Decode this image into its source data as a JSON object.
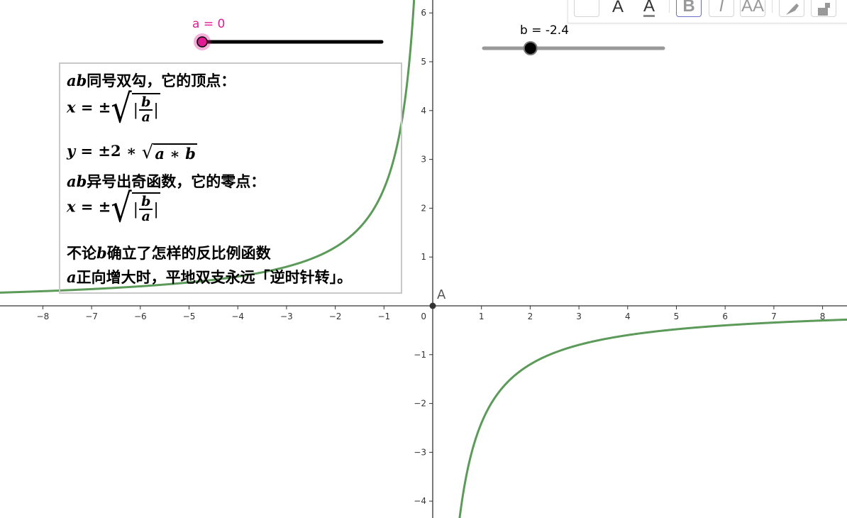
{
  "chart_data": {
    "type": "line",
    "title": "",
    "xlabel": "",
    "ylabel": "",
    "xlim": [
      -8.85,
      8.5
    ],
    "ylim": [
      -4.35,
      6.25
    ],
    "x_ticks": [
      -8,
      -7,
      -6,
      -5,
      -4,
      -3,
      -2,
      -1,
      1,
      2,
      3,
      4,
      5,
      6,
      7,
      8
    ],
    "y_ticks": [
      -4,
      -3,
      -2,
      -1,
      1,
      2,
      3,
      4,
      5,
      6
    ],
    "origin_label": "0",
    "grid": false,
    "series": [
      {
        "function": "y = b / x",
        "parameter_b": -2.4,
        "color": "#5b9a59"
      }
    ],
    "points": [
      {
        "name": "A",
        "x": 0,
        "y": 0,
        "color": "#333333"
      }
    ]
  },
  "sliders": {
    "a": {
      "label": "a = 0",
      "value": 0,
      "min": -5,
      "max": 5,
      "color": "#e21b95"
    },
    "b": {
      "label": "b = -2.4",
      "value": -2.4,
      "min": -5,
      "max": 5,
      "color": "#000000"
    }
  },
  "text_box": {
    "line1_math": "ab",
    "line1_text": "同号双勾，它的顶点：",
    "x_lhs": "x",
    "eq_pm": " = ±",
    "frac_num": "b",
    "frac_den": "a",
    "bar": "|",
    "y_lhs": "y",
    "y_coeff": "2 ∗ ",
    "radicand": "a ∗ b",
    "line4_math": "ab",
    "line4_text": "异号出奇函数，它的零点：",
    "line6_text_a": "不论",
    "line6_math": "b",
    "line6_text_b": "确立了怎样的反比例函数",
    "line7_math": "a",
    "line7_text": "正向增大时，平地双支永远「逆时针转」。"
  },
  "toolbar": {
    "buttons": [
      "",
      "A",
      "A",
      "B",
      "I",
      "AA",
      "pen-icon",
      "fill-icon"
    ]
  },
  "colors": {
    "axis": "#333333",
    "curve": "#5b9a59",
    "slider_a": "#e21b95",
    "slider_track_b": "#999999"
  }
}
